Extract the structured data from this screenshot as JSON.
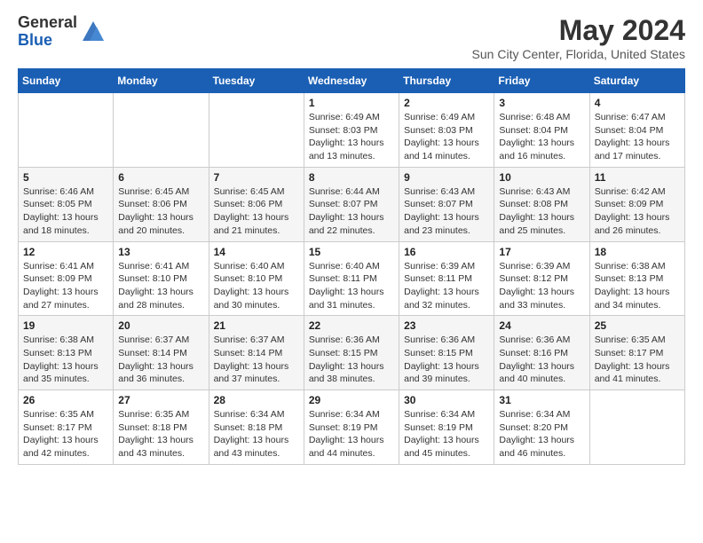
{
  "header": {
    "logo_general": "General",
    "logo_blue": "Blue",
    "title": "May 2024",
    "location": "Sun City Center, Florida, United States"
  },
  "days_of_week": [
    "Sunday",
    "Monday",
    "Tuesday",
    "Wednesday",
    "Thursday",
    "Friday",
    "Saturday"
  ],
  "weeks": [
    [
      {
        "day": "",
        "info": ""
      },
      {
        "day": "",
        "info": ""
      },
      {
        "day": "",
        "info": ""
      },
      {
        "day": "1",
        "info": "Sunrise: 6:49 AM\nSunset: 8:03 PM\nDaylight: 13 hours and 13 minutes."
      },
      {
        "day": "2",
        "info": "Sunrise: 6:49 AM\nSunset: 8:03 PM\nDaylight: 13 hours and 14 minutes."
      },
      {
        "day": "3",
        "info": "Sunrise: 6:48 AM\nSunset: 8:04 PM\nDaylight: 13 hours and 16 minutes."
      },
      {
        "day": "4",
        "info": "Sunrise: 6:47 AM\nSunset: 8:04 PM\nDaylight: 13 hours and 17 minutes."
      }
    ],
    [
      {
        "day": "5",
        "info": "Sunrise: 6:46 AM\nSunset: 8:05 PM\nDaylight: 13 hours and 18 minutes."
      },
      {
        "day": "6",
        "info": "Sunrise: 6:45 AM\nSunset: 8:06 PM\nDaylight: 13 hours and 20 minutes."
      },
      {
        "day": "7",
        "info": "Sunrise: 6:45 AM\nSunset: 8:06 PM\nDaylight: 13 hours and 21 minutes."
      },
      {
        "day": "8",
        "info": "Sunrise: 6:44 AM\nSunset: 8:07 PM\nDaylight: 13 hours and 22 minutes."
      },
      {
        "day": "9",
        "info": "Sunrise: 6:43 AM\nSunset: 8:07 PM\nDaylight: 13 hours and 23 minutes."
      },
      {
        "day": "10",
        "info": "Sunrise: 6:43 AM\nSunset: 8:08 PM\nDaylight: 13 hours and 25 minutes."
      },
      {
        "day": "11",
        "info": "Sunrise: 6:42 AM\nSunset: 8:09 PM\nDaylight: 13 hours and 26 minutes."
      }
    ],
    [
      {
        "day": "12",
        "info": "Sunrise: 6:41 AM\nSunset: 8:09 PM\nDaylight: 13 hours and 27 minutes."
      },
      {
        "day": "13",
        "info": "Sunrise: 6:41 AM\nSunset: 8:10 PM\nDaylight: 13 hours and 28 minutes."
      },
      {
        "day": "14",
        "info": "Sunrise: 6:40 AM\nSunset: 8:10 PM\nDaylight: 13 hours and 30 minutes."
      },
      {
        "day": "15",
        "info": "Sunrise: 6:40 AM\nSunset: 8:11 PM\nDaylight: 13 hours and 31 minutes."
      },
      {
        "day": "16",
        "info": "Sunrise: 6:39 AM\nSunset: 8:11 PM\nDaylight: 13 hours and 32 minutes."
      },
      {
        "day": "17",
        "info": "Sunrise: 6:39 AM\nSunset: 8:12 PM\nDaylight: 13 hours and 33 minutes."
      },
      {
        "day": "18",
        "info": "Sunrise: 6:38 AM\nSunset: 8:13 PM\nDaylight: 13 hours and 34 minutes."
      }
    ],
    [
      {
        "day": "19",
        "info": "Sunrise: 6:38 AM\nSunset: 8:13 PM\nDaylight: 13 hours and 35 minutes."
      },
      {
        "day": "20",
        "info": "Sunrise: 6:37 AM\nSunset: 8:14 PM\nDaylight: 13 hours and 36 minutes."
      },
      {
        "day": "21",
        "info": "Sunrise: 6:37 AM\nSunset: 8:14 PM\nDaylight: 13 hours and 37 minutes."
      },
      {
        "day": "22",
        "info": "Sunrise: 6:36 AM\nSunset: 8:15 PM\nDaylight: 13 hours and 38 minutes."
      },
      {
        "day": "23",
        "info": "Sunrise: 6:36 AM\nSunset: 8:15 PM\nDaylight: 13 hours and 39 minutes."
      },
      {
        "day": "24",
        "info": "Sunrise: 6:36 AM\nSunset: 8:16 PM\nDaylight: 13 hours and 40 minutes."
      },
      {
        "day": "25",
        "info": "Sunrise: 6:35 AM\nSunset: 8:17 PM\nDaylight: 13 hours and 41 minutes."
      }
    ],
    [
      {
        "day": "26",
        "info": "Sunrise: 6:35 AM\nSunset: 8:17 PM\nDaylight: 13 hours and 42 minutes."
      },
      {
        "day": "27",
        "info": "Sunrise: 6:35 AM\nSunset: 8:18 PM\nDaylight: 13 hours and 43 minutes."
      },
      {
        "day": "28",
        "info": "Sunrise: 6:34 AM\nSunset: 8:18 PM\nDaylight: 13 hours and 43 minutes."
      },
      {
        "day": "29",
        "info": "Sunrise: 6:34 AM\nSunset: 8:19 PM\nDaylight: 13 hours and 44 minutes."
      },
      {
        "day": "30",
        "info": "Sunrise: 6:34 AM\nSunset: 8:19 PM\nDaylight: 13 hours and 45 minutes."
      },
      {
        "day": "31",
        "info": "Sunrise: 6:34 AM\nSunset: 8:20 PM\nDaylight: 13 hours and 46 minutes."
      },
      {
        "day": "",
        "info": ""
      }
    ]
  ]
}
